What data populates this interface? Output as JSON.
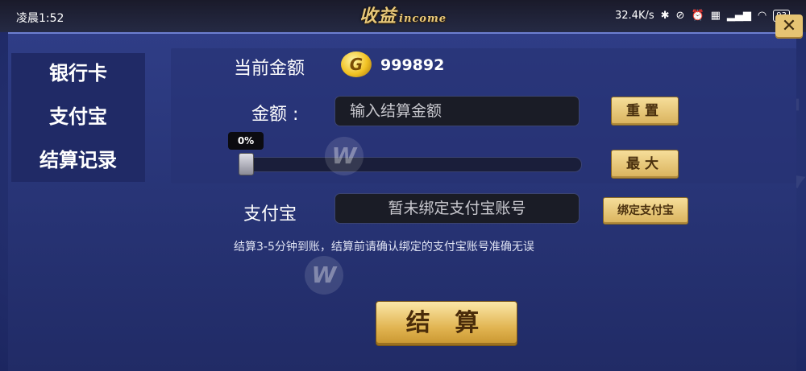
{
  "status_bar": {
    "time": "凌晨1:52",
    "network_speed": "32.4K/s",
    "battery": "93"
  },
  "header": {
    "title": "收益",
    "subtitle": "income"
  },
  "sidebar": {
    "items": [
      {
        "label": "银行卡"
      },
      {
        "label": "支付宝"
      },
      {
        "label": "结算记录"
      }
    ]
  },
  "balance": {
    "label": "当前金额",
    "coin_letter": "G",
    "value": "999892"
  },
  "amount": {
    "label": "金额 :",
    "placeholder": "输入结算金额",
    "reset_label": "重置",
    "max_label": "最大"
  },
  "slider": {
    "percent_label": "0%",
    "value_percent": 0
  },
  "alipay": {
    "label": "支付宝",
    "account_placeholder": "暂未绑定支付宝账号",
    "bind_label": "绑定支付宝"
  },
  "note": "结算3-5分钟到账，结算前请确认绑定的支付宝账号准确无误",
  "submit_label": "结 算",
  "colors": {
    "accent_gold": "#e1b451",
    "panel_blue": "#283578"
  }
}
